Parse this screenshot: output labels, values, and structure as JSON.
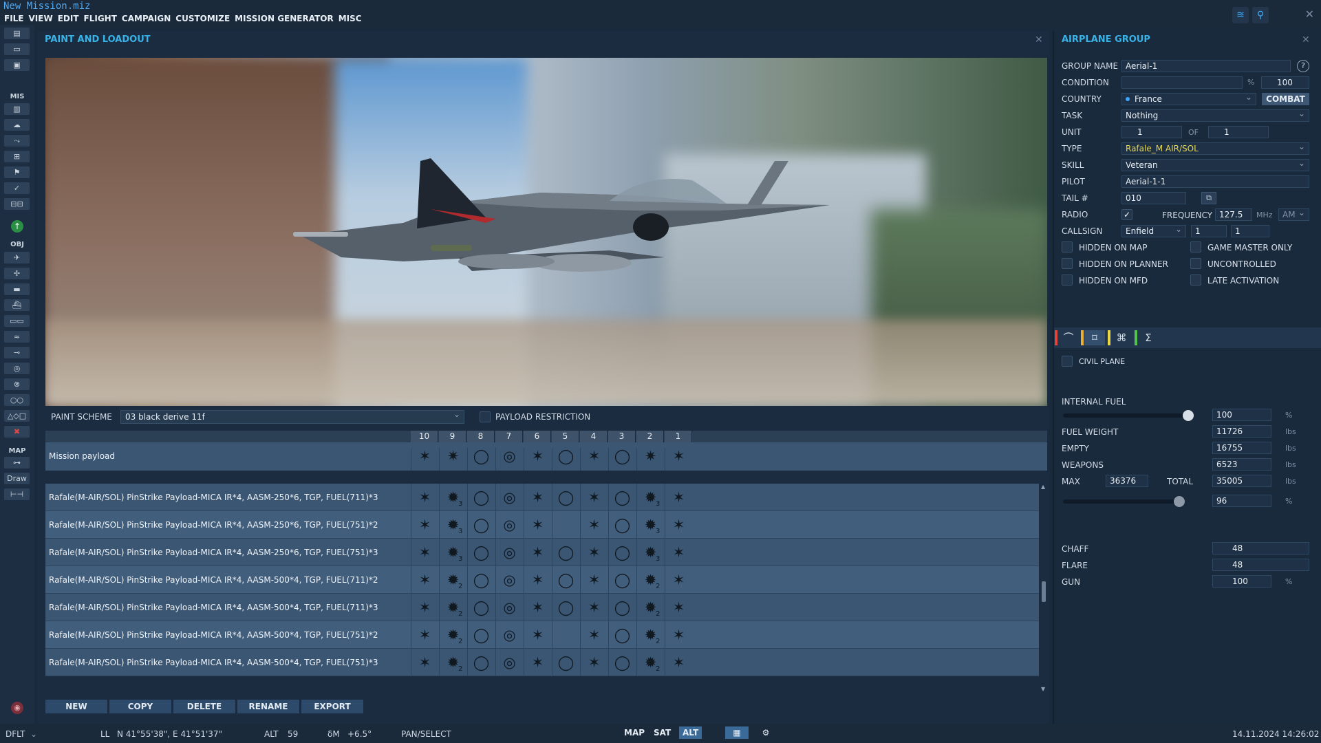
{
  "app": {
    "title": "New Mission.miz"
  },
  "menu": [
    "FILE",
    "VIEW",
    "EDIT",
    "FLIGHT",
    "CAMPAIGN",
    "CUSTOMIZE",
    "MISSION GENERATOR",
    "MISC"
  ],
  "top_icons": [
    "wifi-icon",
    "antenna-icon"
  ],
  "left_sections": {
    "mis": "MIS",
    "obj": "OBJ",
    "map": "MAP",
    "draw": "Draw"
  },
  "paint_panel": {
    "title": "PAINT AND LOADOUT",
    "paint_scheme_label": "PAINT SCHEME",
    "paint_scheme_value": "03 black derive 11f",
    "payload_restriction_label": "PAYLOAD RESTRICTION",
    "columns": [
      "10",
      "9",
      "8",
      "7",
      "6",
      "5",
      "4",
      "3",
      "2",
      "1"
    ],
    "mission_payload_label": "Mission payload",
    "payloads": [
      {
        "name": "Rafale(M-AIR/SOL) PinStrike Payload-MICA IR*4, AASM-250*6, TGP, FUEL(711)*3",
        "counts": {
          "9": "3",
          "2": "3"
        }
      },
      {
        "name": "Rafale(M-AIR/SOL) PinStrike Payload-MICA IR*4, AASM-250*6, TGP, FUEL(751)*2",
        "counts": {
          "9": "3",
          "2": "3"
        }
      },
      {
        "name": "Rafale(M-AIR/SOL) PinStrike Payload-MICA IR*4, AASM-250*6, TGP, FUEL(751)*3",
        "counts": {
          "9": "3",
          "2": "3"
        }
      },
      {
        "name": "Rafale(M-AIR/SOL) PinStrike Payload-MICA IR*4, AASM-500*4, TGP, FUEL(711)*2",
        "counts": {
          "9": "2",
          "2": "2"
        }
      },
      {
        "name": "Rafale(M-AIR/SOL) PinStrike Payload-MICA IR*4, AASM-500*4, TGP, FUEL(711)*3",
        "counts": {
          "9": "2",
          "2": "2"
        }
      },
      {
        "name": "Rafale(M-AIR/SOL) PinStrike Payload-MICA IR*4, AASM-500*4, TGP, FUEL(751)*2",
        "counts": {
          "9": "2",
          "2": "2"
        }
      },
      {
        "name": "Rafale(M-AIR/SOL) PinStrike Payload-MICA IR*4, AASM-500*4, TGP, FUEL(751)*3",
        "counts": {
          "9": "2",
          "2": "2"
        }
      }
    ],
    "buttons": [
      "NEW",
      "COPY",
      "DELETE",
      "RENAME",
      "EXPORT"
    ]
  },
  "group_panel": {
    "title": "AIRPLANE GROUP",
    "group_name_label": "GROUP NAME",
    "group_name": "Aerial-1",
    "condition_label": "CONDITION",
    "condition_pct": "%",
    "condition_value": "100",
    "country_label": "COUNTRY",
    "country": "France",
    "combat_button": "COMBAT",
    "task_label": "TASK",
    "task": "Nothing",
    "unit_label": "UNIT",
    "unit": "1",
    "of_label": "OF",
    "unit_of": "1",
    "type_label": "TYPE",
    "type": "Rafale_M AIR/SOL",
    "skill_label": "SKILL",
    "skill": "Veteran",
    "pilot_label": "PILOT",
    "pilot": "Aerial-1-1",
    "tail_label": "TAIL #",
    "tail": "010",
    "radio_label": "RADIO",
    "frequency_label": "FREQUENCY",
    "frequency": "127.5",
    "mhz": "MHz",
    "modulation": "AM",
    "callsign_label": "CALLSIGN",
    "callsign": "Enfield",
    "callsign_n1": "1",
    "callsign_n2": "1",
    "checkboxes_left": [
      "HIDDEN ON MAP",
      "HIDDEN ON PLANNER",
      "HIDDEN ON MFD"
    ],
    "checkboxes_right": [
      "GAME MASTER ONLY",
      "UNCONTROLLED",
      "LATE ACTIVATION"
    ],
    "civil_plane_label": "CIVIL PLANE",
    "internal_fuel_label": "INTERNAL FUEL",
    "internal_fuel": "100",
    "internal_fuel_level": 1.0,
    "fuel_weight_label": "FUEL WEIGHT",
    "fuel_weight": "11726",
    "empty_label": "EMPTY",
    "empty": "16755",
    "weapons_label": "WEAPONS",
    "weapons": "6523",
    "max_label": "MAX",
    "max": "36376",
    "total_label": "TOTAL",
    "total": "35005",
    "total_pct": "96",
    "total_level": 0.96,
    "lbs": "lbs",
    "pct": "%",
    "chaff_label": "CHAFF",
    "chaff": "48",
    "flare_label": "FLARE",
    "flare": "48",
    "gun_label": "GUN",
    "gun": "100"
  },
  "status": {
    "profile": "DFLT",
    "ll_label": "LL",
    "coords": "N 41°55'38\", E 41°51'37\"",
    "alt_label": "ALT",
    "alt": "59",
    "dm_label": "δM",
    "dm": "+6.5°",
    "mode": "PAN/SELECT",
    "map_buttons": [
      "MAP",
      "SAT",
      "ALT"
    ],
    "datetime": "14.11.2024 14:26:02"
  },
  "colors": {
    "accent": "#38b3e8",
    "type_text": "#e8d84a",
    "tab_marks": [
      "#e0463c",
      "#e8b13a",
      "#e8d84a",
      "#53c24f"
    ]
  }
}
